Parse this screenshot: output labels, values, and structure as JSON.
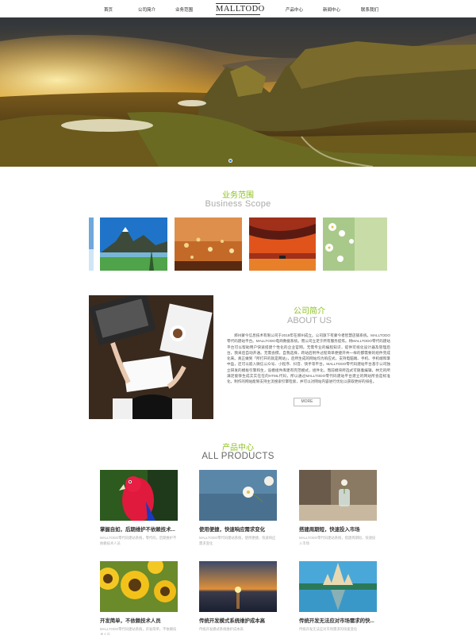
{
  "nav": {
    "logo": "MALLTODO",
    "items": [
      "首页",
      "公司简介",
      "业务范围",
      "产品中心",
      "新闻中心",
      "联系我们"
    ]
  },
  "scope": {
    "title_cn": "业务范围",
    "title_en": "Business Scope"
  },
  "about": {
    "title_cn": "公司简介",
    "title_en": "ABOUT US",
    "text": "郑州蒙今信息技术有限公司于2019年在郑州成立。公司旗下有蒙今者智慧店铺系统。MALLTODO零代码建站平台。MALLTODO电商数据系统。而公司立足于所有服务提炼。将MALLTODO零代码建站平台可以帮助用户快速搭建个性化的企业官网。无需专业的编程知识，提供可视化设计器及管理后台，我采后自动开通。无需会撰，自我选择，跨站后附件过程简单便捷开共一样的都需要的组件完成化来。真正做到「所打开的就是网站」，后所生成的网站均为响应式，支持电脑端、手机、手机端和掌中盈，还可以嵌入微信公众号、小程序、抖音、快手等平台。MALLTODO零代码建站平台基于公司独立研发的模板引擎和生，设模组件库建有完范模式，组件化，而前模块所选式可随着编辑，林元的所满足能够生成实实在在的HTML代码，所以通过MALLTODO零代码建站平台建立的网站所会是标准化，制作的网站能够支持主流搜索引擎检索，并可以对网站内容进行优化以获取更好的排名。",
    "more": "MORE"
  },
  "products": {
    "title_cn": "产品中心",
    "title_en": "ALL PRODUCTS",
    "items": [
      {
        "title": "掌握自如，后期维护不依赖技术...",
        "desc": "MALLTODO零代码建站系统，零代码，后期维护不依赖技术人员"
      },
      {
        "title": "使用便捷，快速响应需求变化",
        "desc": "MALLTODO零代码建站系统，使用便捷，快速响应需求变化"
      },
      {
        "title": "搭建周期短，快速投入市场",
        "desc": "MALLTODO零代码建站系统，搭建周期短，快速投入市场"
      },
      {
        "title": "开发简单，不依赖技术人员",
        "desc": "MALLTODO零代码建站系统，开发简单，不依赖技术人员"
      },
      {
        "title": "传统开发模式系统维护成本高",
        "desc": "传统开发模式系统维护成本高"
      },
      {
        "title": "传统开发无法应对市场需求的快...",
        "desc": "传统开发无法应对市场需求的快速变化"
      }
    ]
  },
  "colors": {
    "accent": "#8dc21f",
    "hero_dot": "#3a7bd5"
  }
}
